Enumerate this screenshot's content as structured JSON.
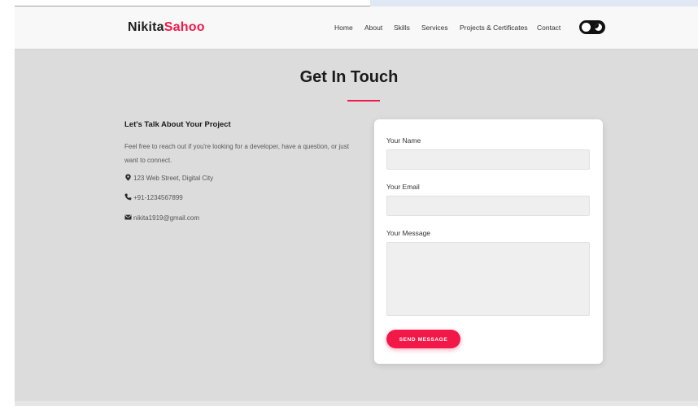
{
  "brand": {
    "name_part1": "Nikita",
    "name_part2": "Sahoo",
    "accent_color": "#f21848"
  },
  "nav": {
    "items": [
      {
        "label": "Home"
      },
      {
        "label": "About"
      },
      {
        "label": "Skills"
      },
      {
        "label": "Services"
      },
      {
        "label": "Projects & Certificates"
      },
      {
        "label": "Contact"
      }
    ],
    "theme_toggle_icon": "moon-toggle-icon"
  },
  "section": {
    "title": "Get In Touch"
  },
  "contact_info": {
    "heading": "Let's Talk About Your Project",
    "description": "Feel free to reach out if you're looking for a developer, have a question, or just want to connect.",
    "address": "123 Web Street, Digital City",
    "phone": "+91-1234567899",
    "email": "nikita1919@gmail.com",
    "icons": {
      "address": "map-marker-icon",
      "phone": "phone-icon",
      "email": "envelope-icon"
    }
  },
  "form": {
    "name_label": "Your Name",
    "name_value": "",
    "email_label": "Your Email",
    "email_value": "",
    "message_label": "Your Message",
    "message_value": "",
    "submit_label": "SEND MESSAGE"
  }
}
